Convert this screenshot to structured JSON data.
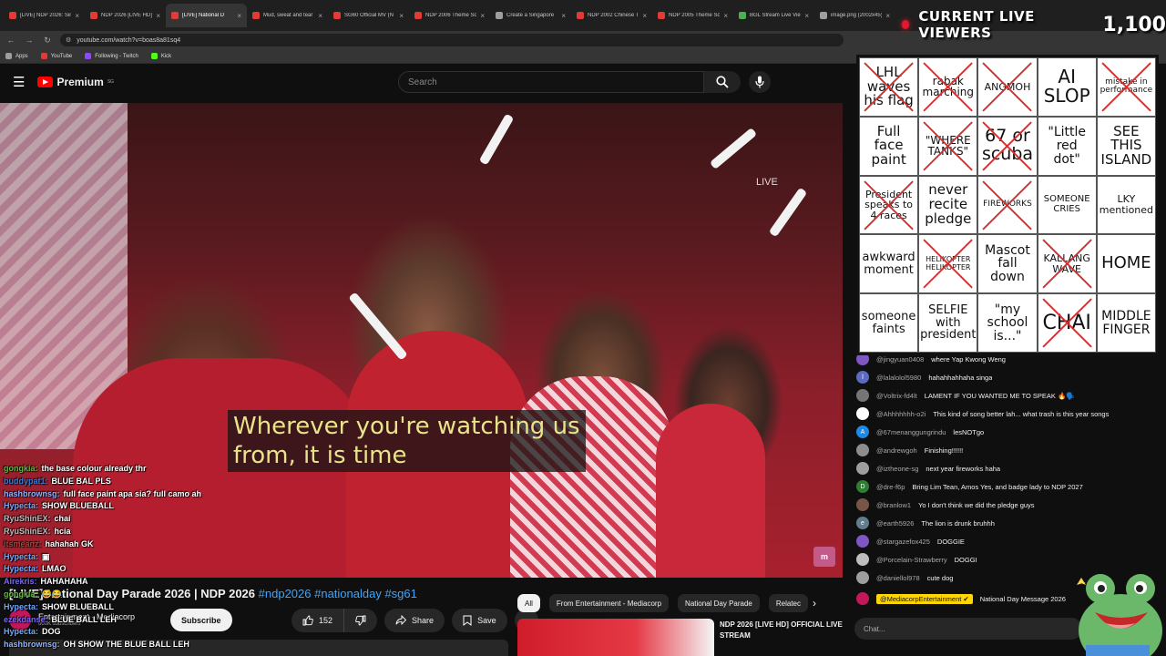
{
  "browser": {
    "tabs": [
      {
        "label": "[LIVE] NDP 2026: Sin",
        "color": "#e53935",
        "active": false
      },
      {
        "label": "NDP 2026 [LIVE HD]",
        "color": "#e53935",
        "active": false
      },
      {
        "label": "[LIVE] National D",
        "color": "#e53935",
        "active": true
      },
      {
        "label": "Mud, sweat and tear",
        "color": "#e53935",
        "active": false
      },
      {
        "label": "SG60 Official MV (N",
        "color": "#e53935",
        "active": false
      },
      {
        "label": "NDP 2006 Theme So",
        "color": "#e53935",
        "active": false
      },
      {
        "label": "Create a Singapore",
        "color": "#9e9e9e",
        "active": false
      },
      {
        "label": "NDP 2002 Chinese T",
        "color": "#e53935",
        "active": false
      },
      {
        "label": "NDP 2005 Theme So",
        "color": "#e53935",
        "active": false
      },
      {
        "label": "BGL Stream Live Vie",
        "color": "#4caf50",
        "active": false
      },
      {
        "label": "image.png (2002x45)",
        "color": "#9e9e9e",
        "active": false
      }
    ],
    "url": "youtube.com/watch?v=boas8a81sq4",
    "bookmarks": [
      {
        "label": "Apps",
        "color": "#9e9e9e"
      },
      {
        "label": "YouTube",
        "color": "#e53935"
      },
      {
        "label": "Following - Twitch",
        "color": "#9146ff"
      },
      {
        "label": "Kick",
        "color": "#53fc18"
      }
    ]
  },
  "youtube": {
    "logo_text": "Premium",
    "logo_sup": "SG",
    "search_placeholder": "Search"
  },
  "video": {
    "subtitle": "Wherever you're watching us\nfrom, it is time",
    "live_label": "LIVE",
    "channel_logo": "m",
    "title_main": "[LIVE] National Day Parade 2026 | NDP 2026",
    "title_tags": "#ndp2026 #nationalday #sg61",
    "channel_name": "Entertainment - Mediacorp",
    "channel_subs": "600K subscribers",
    "subscribe_label": "Subscribe",
    "like_count": "152",
    "share_label": "Share",
    "save_label": "Save"
  },
  "overlay_chat": [
    {
      "user": "gongkia:",
      "text": "the base colour already thr",
      "color": "#6ab04c"
    },
    {
      "user": "buddypat1:",
      "text": "BLUE BAL PLS",
      "color": "#3a7bd5"
    },
    {
      "user": "hashbrownsg:",
      "text": "full face paint apa sia? full camo ah",
      "color": "#8fb3ff"
    },
    {
      "user": "Hypecta:",
      "text": "SHOW BLUEBALL",
      "color": "#6fa8ff"
    },
    {
      "user": "RyuShinEX:",
      "text": "chai",
      "color": "#bbbbbb"
    },
    {
      "user": "RyuShinEX:",
      "text": "hcia",
      "color": "#bbbbbb"
    },
    {
      "user": "itsmeanz:",
      "text": "hahahah GK",
      "color": "#c0392b"
    },
    {
      "user": "Hypecta:",
      "text": "▣",
      "color": "#6fa8ff"
    },
    {
      "user": "Hypecta:",
      "text": "LMAO",
      "color": "#6fa8ff"
    },
    {
      "user": "Airekris:",
      "text": "HAHAHAHA",
      "color": "#7b68ee"
    },
    {
      "user": "gongkia:",
      "text": "😂😂",
      "color": "#6ab04c"
    },
    {
      "user": "Hypecta:",
      "text": "SHOW BLUEBALL",
      "color": "#6fa8ff"
    },
    {
      "user": "ezekdanse:",
      "text": "BLUE BALL LEH",
      "color": "#7b68ee"
    },
    {
      "user": "Hypecta:",
      "text": "DOG",
      "color": "#6fa8ff"
    },
    {
      "user": "hashbrownsg:",
      "text": "OH SHOW THE BLUE BALL LEH",
      "color": "#8fb3ff"
    }
  ],
  "chips": [
    "All",
    "From Entertainment - Mediacorp",
    "National Day Parade",
    "Relatec"
  ],
  "related": {
    "title": "NDP 2026 [LIVE HD] OFFICIAL LIVE STREAM"
  },
  "live_chat": [
    {
      "avatar_color": "#7e57c2",
      "avatar_text": "",
      "user": "@jingyuan0408",
      "text": "where Yap Kwong Weng"
    },
    {
      "avatar_color": "#5c6bc0",
      "avatar_text": "l",
      "user": "@lalalolol5980",
      "text": "hahahhahhaha singa"
    },
    {
      "avatar_color": "#757575",
      "avatar_text": "",
      "user": "@Voltrix-fd4lt",
      "text": "LAMENT IF YOU WANTED ME TO SPEAK 🔥🗣️"
    },
    {
      "avatar_color": "#ffffff",
      "avatar_text": "",
      "user": "@Ahhhhhhh-o2i",
      "text": "This kind of song better lah... what trash is this year songs"
    },
    {
      "avatar_color": "#1e88e5",
      "avatar_text": "A",
      "user": "@67menanggungrindu",
      "text": "lesNOTgo"
    },
    {
      "avatar_color": "#8d8d8d",
      "avatar_text": "",
      "user": "@andrewgoh",
      "text": "Finishing!!!!!!"
    },
    {
      "avatar_color": "#9e9e9e",
      "avatar_text": "",
      "user": "@iztheone-sg",
      "text": "next year fireworks haha"
    },
    {
      "avatar_color": "#2e7d32",
      "avatar_text": "D",
      "user": "@dre-f6p",
      "text": "Bring Lim Tean, Amos Yes, and badge lady to NDP 2027"
    },
    {
      "avatar_color": "#795548",
      "avatar_text": "",
      "user": "@branlow1",
      "text": "Yo I don't think we did the pledge guys"
    },
    {
      "avatar_color": "#607d8b",
      "avatar_text": "e",
      "user": "@earth5926",
      "text": "The lion is drunk bruhhh"
    },
    {
      "avatar_color": "#7e57c2",
      "avatar_text": "",
      "user": "@stargazefox425",
      "text": "DOGGIE"
    },
    {
      "avatar_color": "#bdbdbd",
      "avatar_text": "",
      "user": "@Porcelain-Strawberry",
      "text": "DOGGI"
    },
    {
      "avatar_color": "#9e9e9e",
      "avatar_text": "",
      "user": "@daniellol978",
      "text": "cute dog"
    }
  ],
  "pinned": {
    "user": "@MediacorpEntertainment ✔",
    "text": "National Day Message 2026"
  },
  "chat_input_placeholder": "Chat...",
  "viewers": {
    "label": "CURRENT LIVE VIEWERS",
    "count": "1,100"
  },
  "bingo": [
    {
      "text": "LHL\nwaves\nhis flag",
      "crossed": true,
      "size": 15
    },
    {
      "text": "rabak\nmarching",
      "crossed": true,
      "size": 12
    },
    {
      "text": "ANGMOH",
      "crossed": true,
      "size": 11
    },
    {
      "text": "AI\nSLOP",
      "crossed": false,
      "size": 20
    },
    {
      "text": "mistake in\nperformance",
      "crossed": true,
      "size": 9
    },
    {
      "text": "Full\nface\npaint",
      "crossed": false,
      "size": 15
    },
    {
      "text": "\"WHERE\nTANKS\"",
      "crossed": true,
      "size": 12
    },
    {
      "text": "67 or\nscuba",
      "crossed": true,
      "size": 19
    },
    {
      "text": "\"Little\nred\ndot\"",
      "crossed": false,
      "size": 14
    },
    {
      "text": "SEE\nTHIS\nISLAND",
      "crossed": false,
      "size": 15
    },
    {
      "text": "President\nspeaks to\n4 races",
      "crossed": true,
      "size": 11
    },
    {
      "text": "never\nrecite\npledge",
      "crossed": false,
      "size": 15
    },
    {
      "text": "FIREWORKS",
      "crossed": true,
      "size": 9
    },
    {
      "text": "SOMEONE\nCRIES",
      "crossed": false,
      "size": 10
    },
    {
      "text": "LKY\nmentioned",
      "crossed": false,
      "size": 11
    },
    {
      "text": "awkward\nmoment",
      "crossed": false,
      "size": 13
    },
    {
      "text": "HELIKOPTER\nHELIKOPTER",
      "crossed": true,
      "size": 8
    },
    {
      "text": "Mascot\nfall\ndown",
      "crossed": false,
      "size": 14
    },
    {
      "text": "KALLANG\nWAVE",
      "crossed": true,
      "size": 11
    },
    {
      "text": "HOME",
      "crossed": false,
      "size": 18
    },
    {
      "text": "someone\nfaints",
      "crossed": false,
      "size": 13
    },
    {
      "text": "SELFIE\nwith\npresident",
      "crossed": false,
      "size": 13
    },
    {
      "text": "\"my\nschool\nis...\"",
      "crossed": false,
      "size": 14
    },
    {
      "text": "CHAI",
      "crossed": true,
      "size": 22
    },
    {
      "text": "MIDDLE\nFINGER",
      "crossed": false,
      "size": 14
    }
  ]
}
